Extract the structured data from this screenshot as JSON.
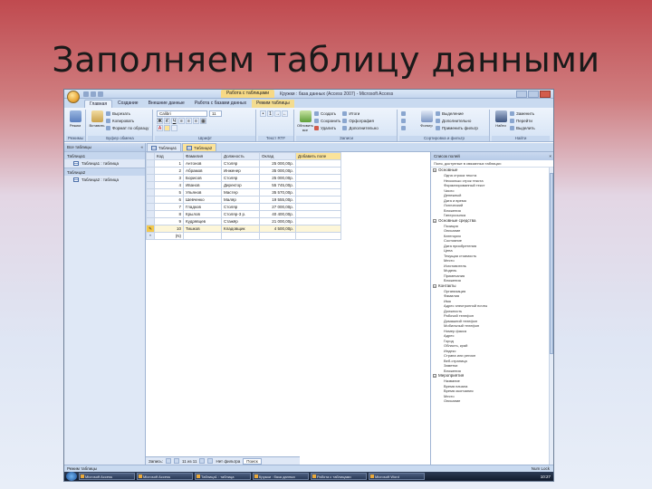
{
  "slide": {
    "title": "Заполняем таблицу данными"
  },
  "window": {
    "context_tab": "Работа с таблицами",
    "title": "Кружки : база данных (Access 2007) - Microsoft Access"
  },
  "tabs": [
    "Главная",
    "Создание",
    "Внешние данные",
    "Работа с базами данных",
    "Режим таблицы"
  ],
  "ribbon": {
    "groups": [
      {
        "label": "Режимы",
        "big": "Режим"
      },
      {
        "label": "Буфер обмена",
        "big": "Вставить",
        "small": [
          "Вырезать",
          "Копировать",
          "Формат по образцу"
        ]
      },
      {
        "label": "Шрифт",
        "font": "Calibri",
        "size": "11"
      },
      {
        "label": "Текст RTF"
      },
      {
        "label": "Записи",
        "big": "Обновить все",
        "small": [
          "Создать",
          "Сохранить",
          "Удалить",
          "Итоги",
          "Орфография",
          "Дополнительно"
        ]
      },
      {
        "label": "Сортировка и фильтр",
        "big": "Фильтр",
        "small": [
          "Выделение",
          "Дополнительно",
          "Применить фильтр"
        ]
      },
      {
        "label": "Найти",
        "big": "Найти",
        "small": [
          "Заменить",
          "Перейти",
          "Выделить"
        ]
      }
    ]
  },
  "nav": {
    "header": "Все таблицы",
    "groups": [
      {
        "label": "Таблица1",
        "item": "Таблица1 : таблица"
      },
      {
        "label": "Таблица2",
        "item": "Таблица2 : таблица"
      }
    ]
  },
  "doc_tabs": [
    "Таблица1",
    "Таблица2"
  ],
  "grid": {
    "columns": [
      "Код",
      "Фамилия",
      "Должность",
      "Оклад",
      "Добавить поле"
    ],
    "rows": [
      [
        "1",
        "Антонов",
        "Столяр",
        "25 000,00р."
      ],
      [
        "2",
        "Абрамов",
        "Инженер",
        "35 000,00р."
      ],
      [
        "3",
        "Борисов",
        "Столяр",
        "25 000,00р."
      ],
      [
        "4",
        "Иванов",
        "Директор",
        "55 745,00р."
      ],
      [
        "5",
        "Ульянов",
        "Мастер",
        "35 570,00р."
      ],
      [
        "6",
        "Шевченко",
        "Маляр",
        "19 555,00р."
      ],
      [
        "7",
        "Гладков",
        "Столяр",
        "27 000,00р."
      ],
      [
        "8",
        "Крылов",
        "Столяр-3 р.",
        "40 400,00р."
      ],
      [
        "9",
        "Кудрявцев",
        "Стажёр",
        "21 000,00р."
      ],
      [
        "10",
        "Тишков",
        "Кладовщик",
        "4 500,00р."
      ]
    ],
    "new_row_marker": "(N)"
  },
  "field_list": {
    "header": "Список полей",
    "subtitle": "Поля, доступные в связанных таблицах:",
    "categories": [
      {
        "name": "Основные",
        "items": [
          "Одна строка текста",
          "Несколько строк текста",
          "Форматированный текст",
          "Число",
          "Денежный",
          "Дата и время",
          "Логический",
          "Вложения",
          "Гиперссылка"
        ]
      },
      {
        "name": "Основные средства",
        "items": [
          "Позиция",
          "Описание",
          "Категория",
          "Состояние",
          "Дата приобретения",
          "Цена",
          "Текущая стоимость",
          "Место",
          "Изготовитель",
          "Модель",
          "Примечания",
          "Вложения"
        ]
      },
      {
        "name": "Контакты",
        "items": [
          "Организация",
          "Фамилия",
          "Имя",
          "Адрес электронной почты",
          "Должность",
          "Рабочий телефон",
          "Домашний телефон",
          "Мобильный телефон",
          "Номер факса",
          "Адрес",
          "Город",
          "Область, край",
          "Индекс",
          "Страна или регион",
          "Веб-страница",
          "Заметки",
          "Вложения"
        ]
      },
      {
        "name": "Мероприятия",
        "items": [
          "Название",
          "Время начала",
          "Время окончания",
          "Место",
          "Описание"
        ]
      }
    ]
  },
  "record_nav": {
    "label": "Запись:",
    "position": "11 из 11",
    "filter": "Нет фильтра",
    "search": "Поиск"
  },
  "status": {
    "left": "Режим таблицы",
    "right": "Num Lock"
  },
  "taskbar": {
    "items": [
      "Microsoft Access",
      "Microsoft Access",
      "Таблица1 : таблица",
      "Кружки : база данных",
      "Работа с таблицами",
      "Microsoft Word"
    ],
    "clock": "10:27"
  },
  "colors": {
    "accent": "#fbe39a",
    "ribbon": "#d5e3f5"
  }
}
